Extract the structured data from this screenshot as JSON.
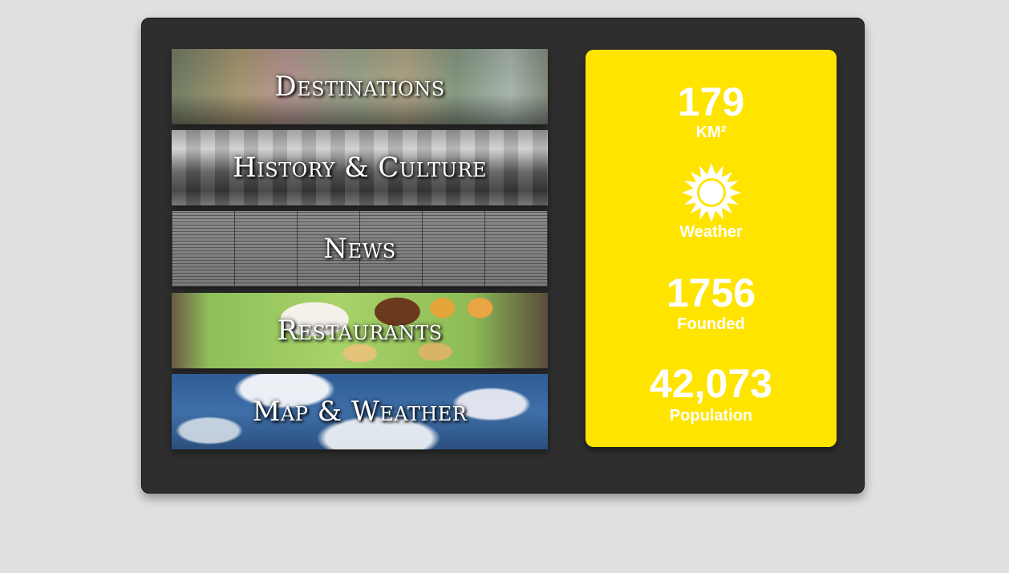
{
  "menu": {
    "items": [
      {
        "label": "Destinations"
      },
      {
        "label": "History & Culture"
      },
      {
        "label": "News"
      },
      {
        "label": "Restaurants"
      },
      {
        "label": "Map & Weather"
      }
    ]
  },
  "stats": {
    "area": {
      "value": "179",
      "unit": "KM²"
    },
    "weather": {
      "icon": "sun-icon",
      "label": "Weather"
    },
    "founded": {
      "value": "1756",
      "label": "Founded"
    },
    "population": {
      "value": "42,073",
      "label": "Population"
    }
  },
  "colors": {
    "panel": "#2e2e2e",
    "stats_bg": "#ffe400",
    "page_bg": "#e0e0e0"
  }
}
